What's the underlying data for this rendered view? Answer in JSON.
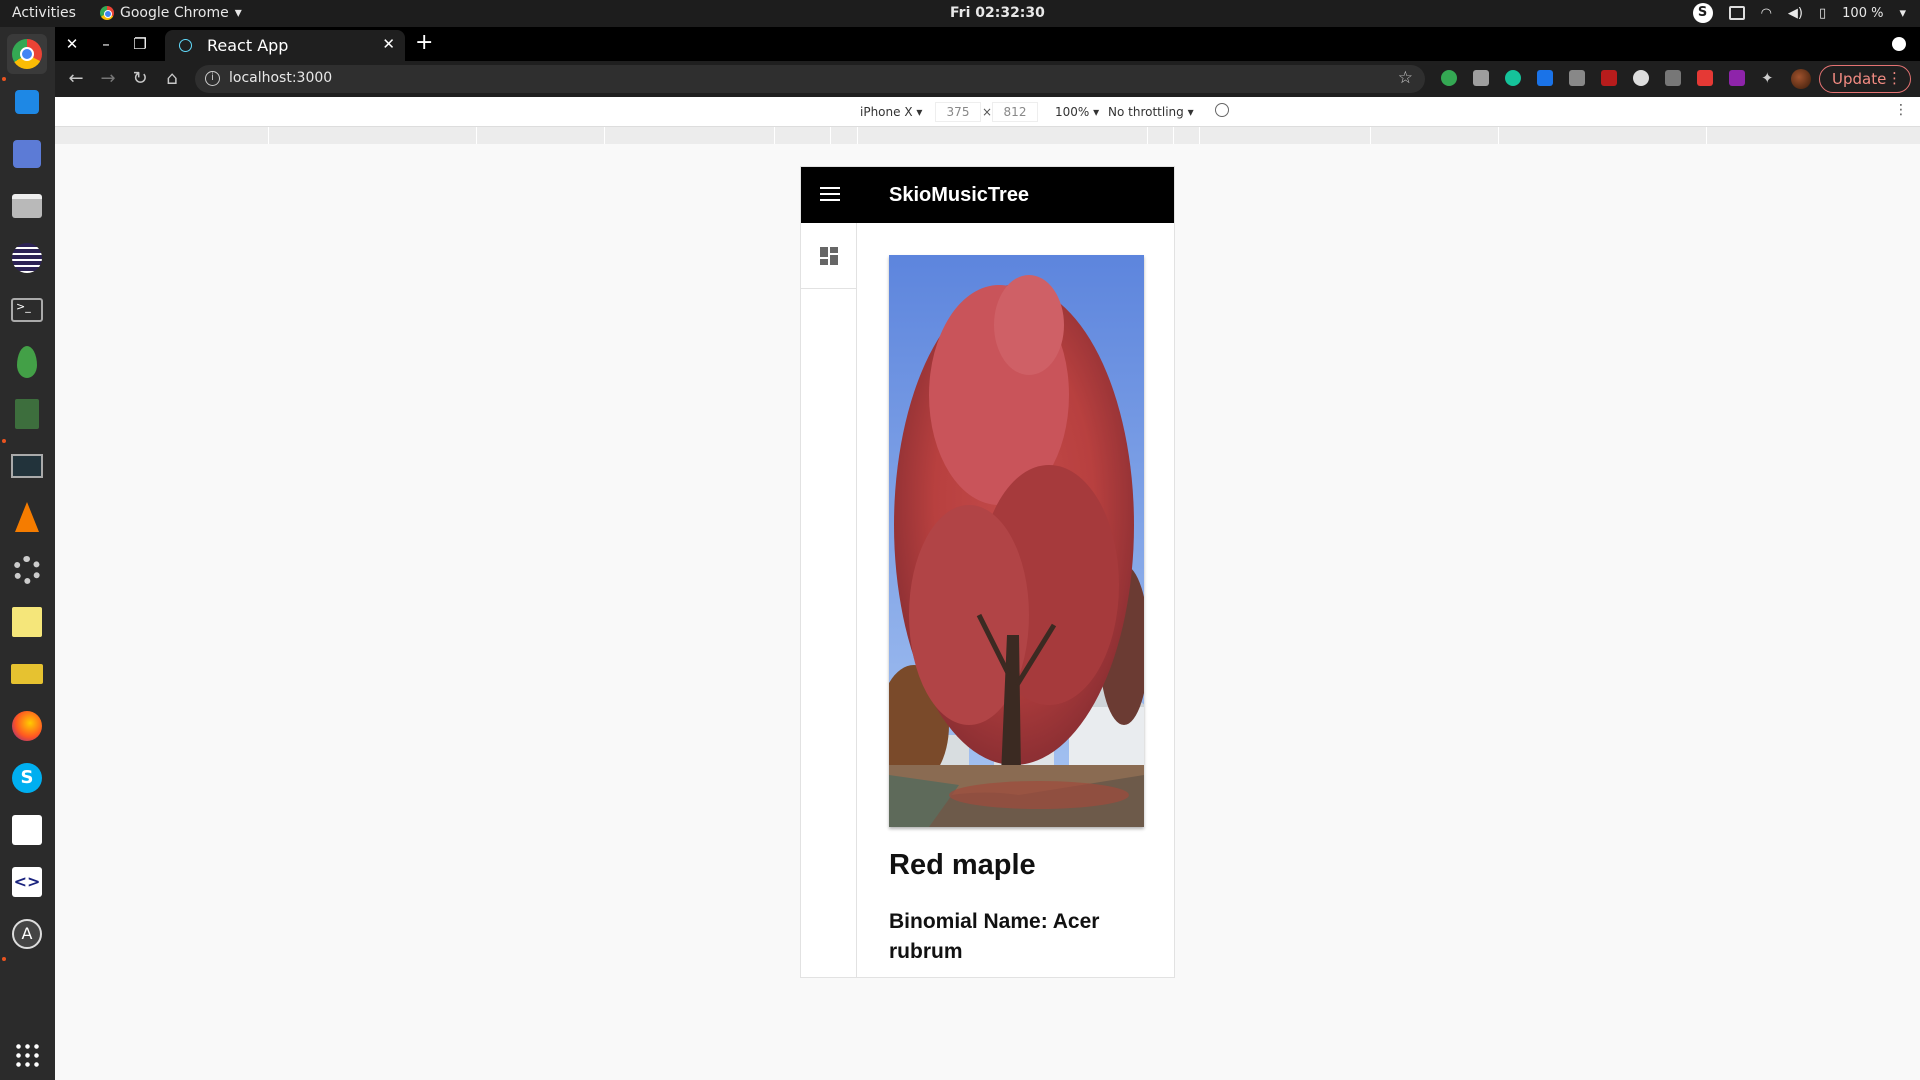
{
  "system": {
    "activities": "Activities",
    "app_name": "Google Chrome",
    "clock": "Fri 02:32:30",
    "battery": "100 %",
    "skype_badge": "S"
  },
  "browser": {
    "tab_title": "React App",
    "url": "localhost:3000",
    "update_label": "Update",
    "new_tab": "+"
  },
  "device_toolbar": {
    "device": "iPhone X ▾",
    "width": "375",
    "times": "×",
    "height": "812",
    "zoom": "100% ▾",
    "throttling": "No throttling ▾"
  },
  "app": {
    "title": "SkioMusicTree",
    "tree_name": "Red maple",
    "binomial": "Binomial Name: Acer rubrum"
  },
  "colors": {
    "app_bar": "#000000",
    "accent_update": "#f28b82"
  }
}
